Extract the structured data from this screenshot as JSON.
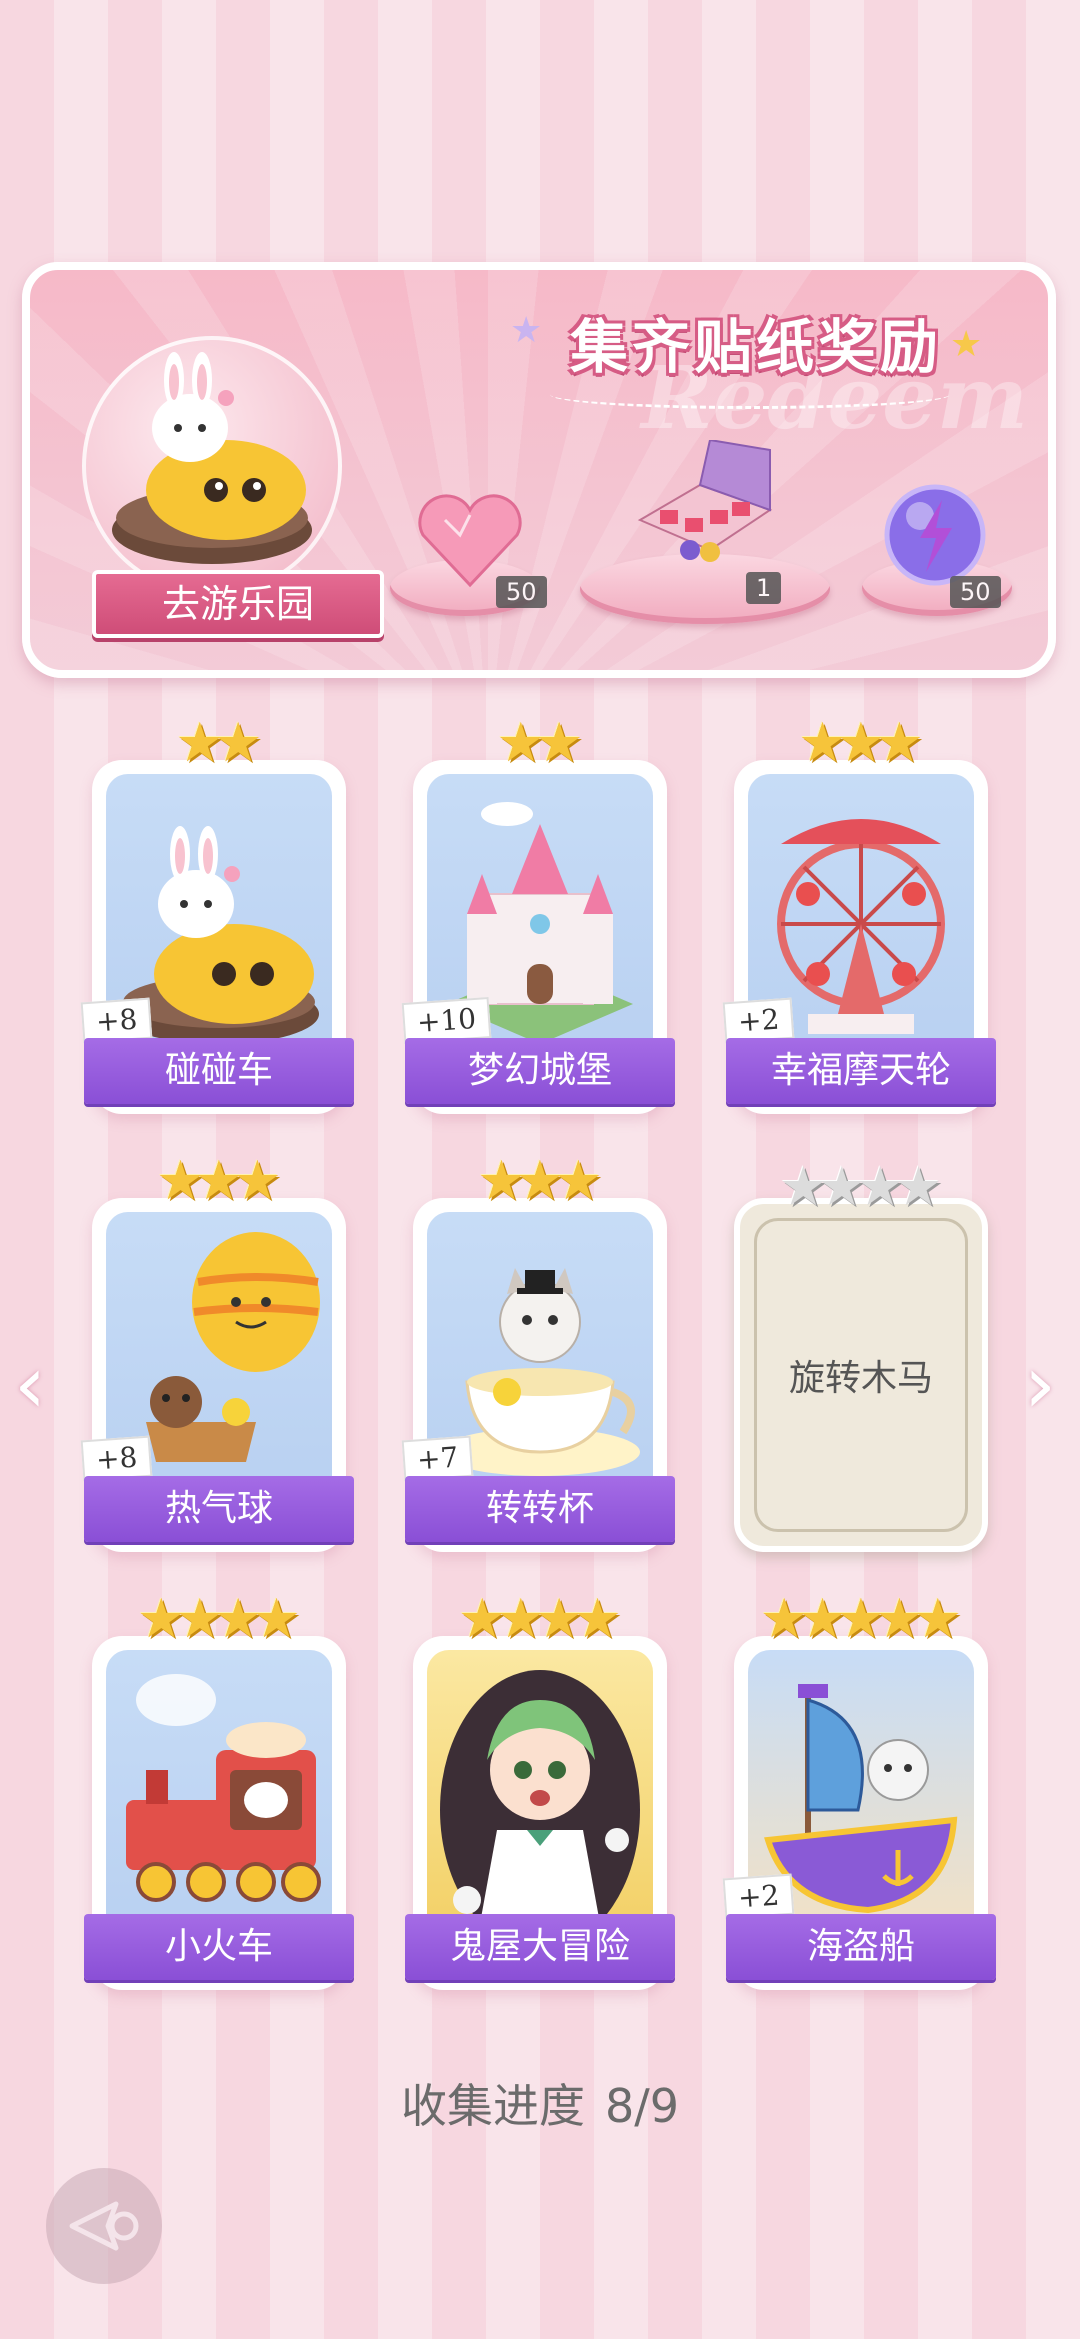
{
  "banner": {
    "title": "集齐贴纸奖励",
    "background_word": "Redeem",
    "go_button": "去游乐园",
    "rewards": [
      {
        "icon": "heart-gem-icon",
        "count": "50"
      },
      {
        "icon": "gift-box-icon",
        "count": "1"
      },
      {
        "icon": "energy-orb-icon",
        "count": "50"
      }
    ]
  },
  "cards": [
    {
      "name": "碰碰车",
      "stars": 2,
      "bonus": "+8",
      "icon": "bumper-car-icon",
      "collected": true
    },
    {
      "name": "梦幻城堡",
      "stars": 2,
      "bonus": "+10",
      "icon": "castle-icon",
      "collected": true
    },
    {
      "name": "幸福摩天轮",
      "stars": 3,
      "bonus": "+2",
      "icon": "ferris-wheel-icon",
      "collected": true
    },
    {
      "name": "热气球",
      "stars": 3,
      "bonus": "+8",
      "icon": "hot-air-balloon-icon",
      "collected": true
    },
    {
      "name": "转转杯",
      "stars": 3,
      "bonus": "+7",
      "icon": "teacup-icon",
      "collected": true
    },
    {
      "name": "旋转木马",
      "stars": 4,
      "bonus": "",
      "icon": "carousel-icon",
      "collected": false
    },
    {
      "name": "小火车",
      "stars": 4,
      "bonus": "",
      "icon": "train-icon",
      "collected": true
    },
    {
      "name": "鬼屋大冒险",
      "stars": 4,
      "bonus": "",
      "icon": "haunted-house-icon",
      "collected": true
    },
    {
      "name": "海盗船",
      "stars": 5,
      "bonus": "+2",
      "icon": "pirate-ship-icon",
      "collected": true
    }
  ],
  "progress": {
    "label": "收集进度",
    "value": "8/9"
  },
  "colors": {
    "accent": "#8a4fd6",
    "pink": "#e56b92",
    "star": "#f6c43a"
  }
}
